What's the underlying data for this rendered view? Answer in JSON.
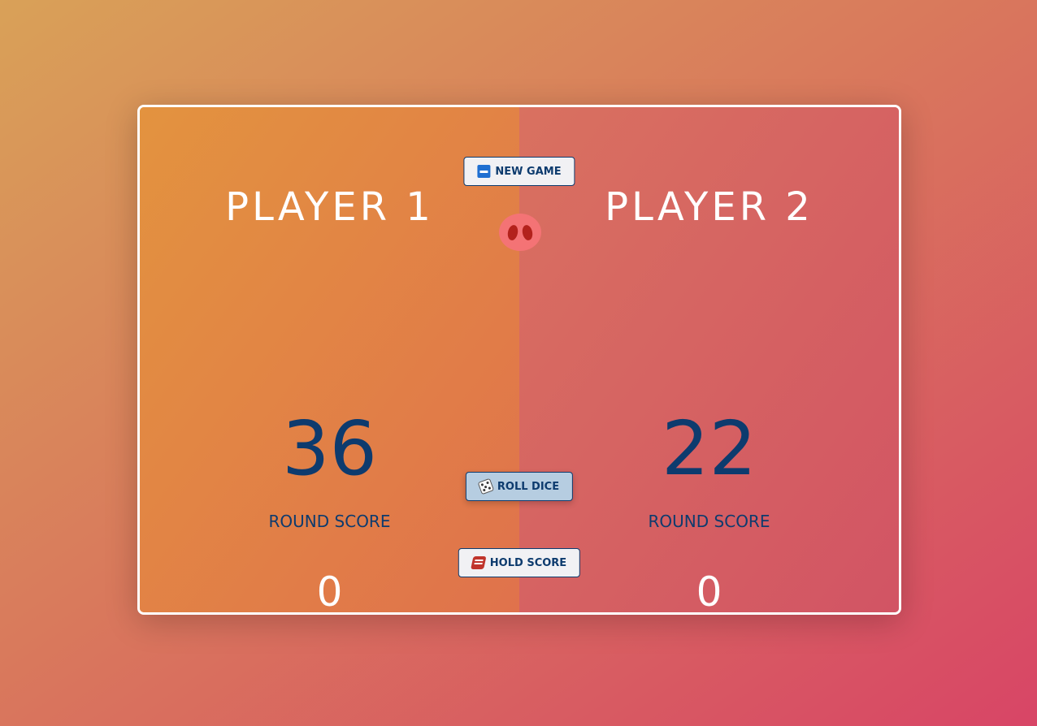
{
  "player1": {
    "name": "PLAYER 1",
    "score": "36",
    "round_label": "ROUND SCORE",
    "round_score": "0"
  },
  "player2": {
    "name": "PLAYER 2",
    "score": "22",
    "round_label": "ROUND SCORE",
    "round_score": "0"
  },
  "controls": {
    "new_game": "NEW GAME",
    "roll_dice": "ROLL DICE",
    "hold_score": "HOLD SCORE"
  },
  "icons": {
    "new_game": "minus-square-icon",
    "roll_dice": "dice-icon",
    "hold_score": "money-icon",
    "dice_display": "pig-nose-icon"
  },
  "colors": {
    "score_text": "#0d3b6e",
    "player1_bg": "#e3933f",
    "player2_bg": "#d97160",
    "button_bg": "#f1f1f4",
    "roll_button_bg": "#b6cde1"
  }
}
